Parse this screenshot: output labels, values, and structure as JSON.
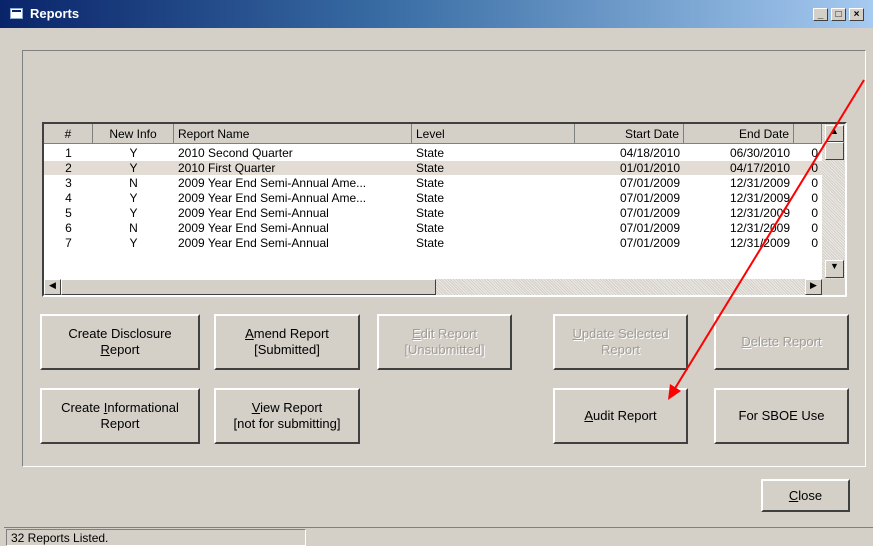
{
  "window": {
    "title": "Reports"
  },
  "grid": {
    "columns": [
      "#",
      "New Info",
      "Report Name",
      "Level",
      "Start Date",
      "End Date"
    ],
    "rows": [
      {
        "num": "1",
        "new": "Y",
        "name": "2010 Second Quarter",
        "level": "State",
        "start": "04/18/2010",
        "end": "06/30/2010",
        "extra": "0"
      },
      {
        "num": "2",
        "new": "Y",
        "name": "2010 First Quarter",
        "level": "State",
        "start": "01/01/2010",
        "end": "04/17/2010",
        "extra": "0"
      },
      {
        "num": "3",
        "new": "N",
        "name": "2009 Year End Semi-Annual Ame...",
        "level": "State",
        "start": "07/01/2009",
        "end": "12/31/2009",
        "extra": "0"
      },
      {
        "num": "4",
        "new": "Y",
        "name": "2009 Year End Semi-Annual Ame...",
        "level": "State",
        "start": "07/01/2009",
        "end": "12/31/2009",
        "extra": "0"
      },
      {
        "num": "5",
        "new": "Y",
        "name": "2009 Year End Semi-Annual",
        "level": "State",
        "start": "07/01/2009",
        "end": "12/31/2009",
        "extra": "0"
      },
      {
        "num": "6",
        "new": "N",
        "name": "2009 Year End Semi-Annual",
        "level": "State",
        "start": "07/01/2009",
        "end": "12/31/2009",
        "extra": "0"
      },
      {
        "num": "7",
        "new": "Y",
        "name": "2009 Year End Semi-Annual",
        "level": "State",
        "start": "07/01/2009",
        "end": "12/31/2009",
        "extra": "0"
      }
    ]
  },
  "buttons": {
    "create_disclosure": {
      "pre": "Create Disclosure",
      "u": "R",
      "post": "eport"
    },
    "amend_report": {
      "u": "A",
      "line1": "mend Report",
      "line2": "[Submitted]"
    },
    "edit_report": {
      "u": "E",
      "line1": "dit Report",
      "line2": "[Unsubmitted]"
    },
    "update_selected": {
      "u": "U",
      "line1": "pdate Selected",
      "line2": "Report"
    },
    "delete_report": {
      "u": "D",
      "post": "elete Report"
    },
    "create_informational": {
      "pre": "Create ",
      "u": "I",
      "post": "nformational",
      "line2": "Report"
    },
    "view_report": {
      "u": "V",
      "line1": "iew Report",
      "line2": "[not for submitting]"
    },
    "audit_report": {
      "u": "A",
      "post": "udit Report"
    },
    "sboe_use": {
      "label": "For SBOE Use"
    },
    "close": {
      "u": "C",
      "post": "lose"
    }
  },
  "status": {
    "text": "32 Reports Listed."
  },
  "colors": {
    "annotation_arrow": "#ff0000",
    "title_bar": "#0a246a"
  }
}
